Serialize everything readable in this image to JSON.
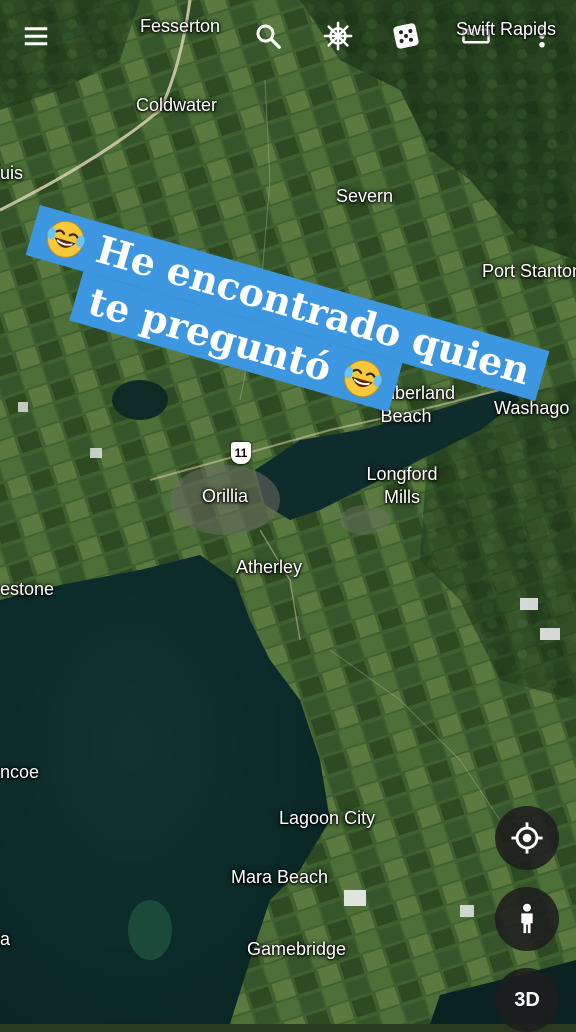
{
  "colors": {
    "banner": "#3d96e0",
    "label_text": "#ffffff",
    "fab_bg": "#1e1e1e",
    "water": "#0d2a2a",
    "land": "#3a5a2a"
  },
  "toolbar": {
    "menu_icon": "hamburger-icon",
    "search_icon": "search-icon",
    "voyager_icon": "ships-wheel-icon",
    "random_icon": "dice-icon",
    "measure_icon": "ruler-icon",
    "more_icon": "vertical-dots-icon"
  },
  "places": {
    "fesserton": "Fesserton",
    "swift_rapids": "Swift Rapids",
    "coldwater": "Coldwater",
    "uis": "uis",
    "severn": "Severn",
    "port_stanton": "Port Stanton",
    "cumberland_beach": "Cumberland\nBeach",
    "washago": "Washago",
    "longford_mills": "Longford\nMills",
    "orillia": "Orillia",
    "atherley": "Atherley",
    "estone": "estone",
    "ncoe": "ncoe",
    "lagoon_city": "Lagoon City",
    "mara_beach": "Mara Beach",
    "gamebridge": "Gamebridge",
    "a_partial": "a"
  },
  "highway_shield": "11",
  "banner": {
    "line1": "He encontrado quien",
    "line2": "te preguntó",
    "emoji": "laughing-tears-emoji"
  },
  "controls": {
    "locate_icon": "my-location-icon",
    "pegman_icon": "pegman-icon",
    "view3d_label": "3D"
  }
}
